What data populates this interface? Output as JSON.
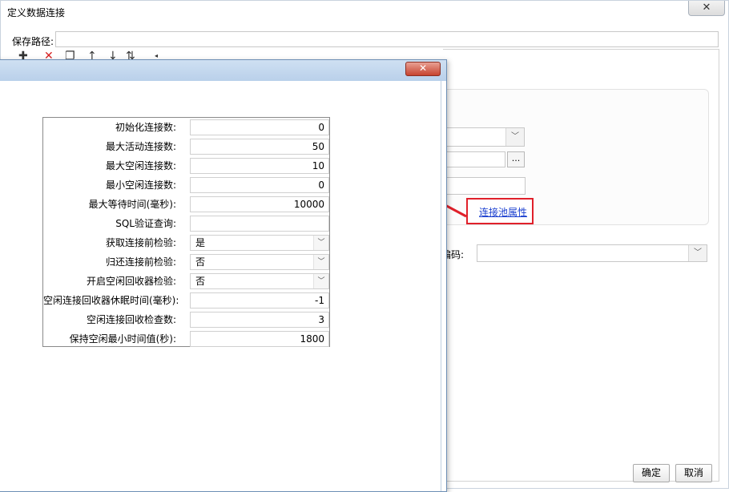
{
  "main_window": {
    "title": "定义数据连接",
    "close_glyph": "✕",
    "path_label": "保存路径:",
    "path_value": "",
    "pool_link": "连接池属性",
    "encoding_label": "编码:",
    "encoding_value": "",
    "ok_label": "确定",
    "cancel_label": "取消",
    "url_more": "...",
    "toolbar_icons": [
      "add-icon",
      "delete-icon",
      "copy-icon",
      "move-up-icon",
      "move-down-icon",
      "sort-icon"
    ]
  },
  "dialog": {
    "title": "ᅠ",
    "close_glyph": "✕",
    "properties": [
      {
        "label": "初始化连接数:",
        "value": "0",
        "kind": "number"
      },
      {
        "label": "最大活动连接数:",
        "value": "50",
        "kind": "number"
      },
      {
        "label": "最大空闲连接数:",
        "value": "10",
        "kind": "number"
      },
      {
        "label": "最小空闲连接数:",
        "value": "0",
        "kind": "number"
      },
      {
        "label": "最大等待时间(毫秒):",
        "value": "10000",
        "kind": "number"
      },
      {
        "label": "SQL验证查询:",
        "value": "",
        "kind": "text"
      },
      {
        "label": "获取连接前检验:",
        "value": "是",
        "kind": "select"
      },
      {
        "label": "归还连接前检验:",
        "value": "否",
        "kind": "select"
      },
      {
        "label": "开启空闲回收器检验:",
        "value": "否",
        "kind": "select"
      },
      {
        "label": "空闲连接回收器休眠时间(毫秒):",
        "value": "-1",
        "kind": "number"
      },
      {
        "label": "空闲连接回收检查数:",
        "value": "3",
        "kind": "number"
      },
      {
        "label": "保持空闲最小时间值(秒):",
        "value": "1800",
        "kind": "number"
      }
    ]
  },
  "colors": {
    "annotation_red": "#e0202a",
    "link_blue": "#1a3fcf"
  }
}
